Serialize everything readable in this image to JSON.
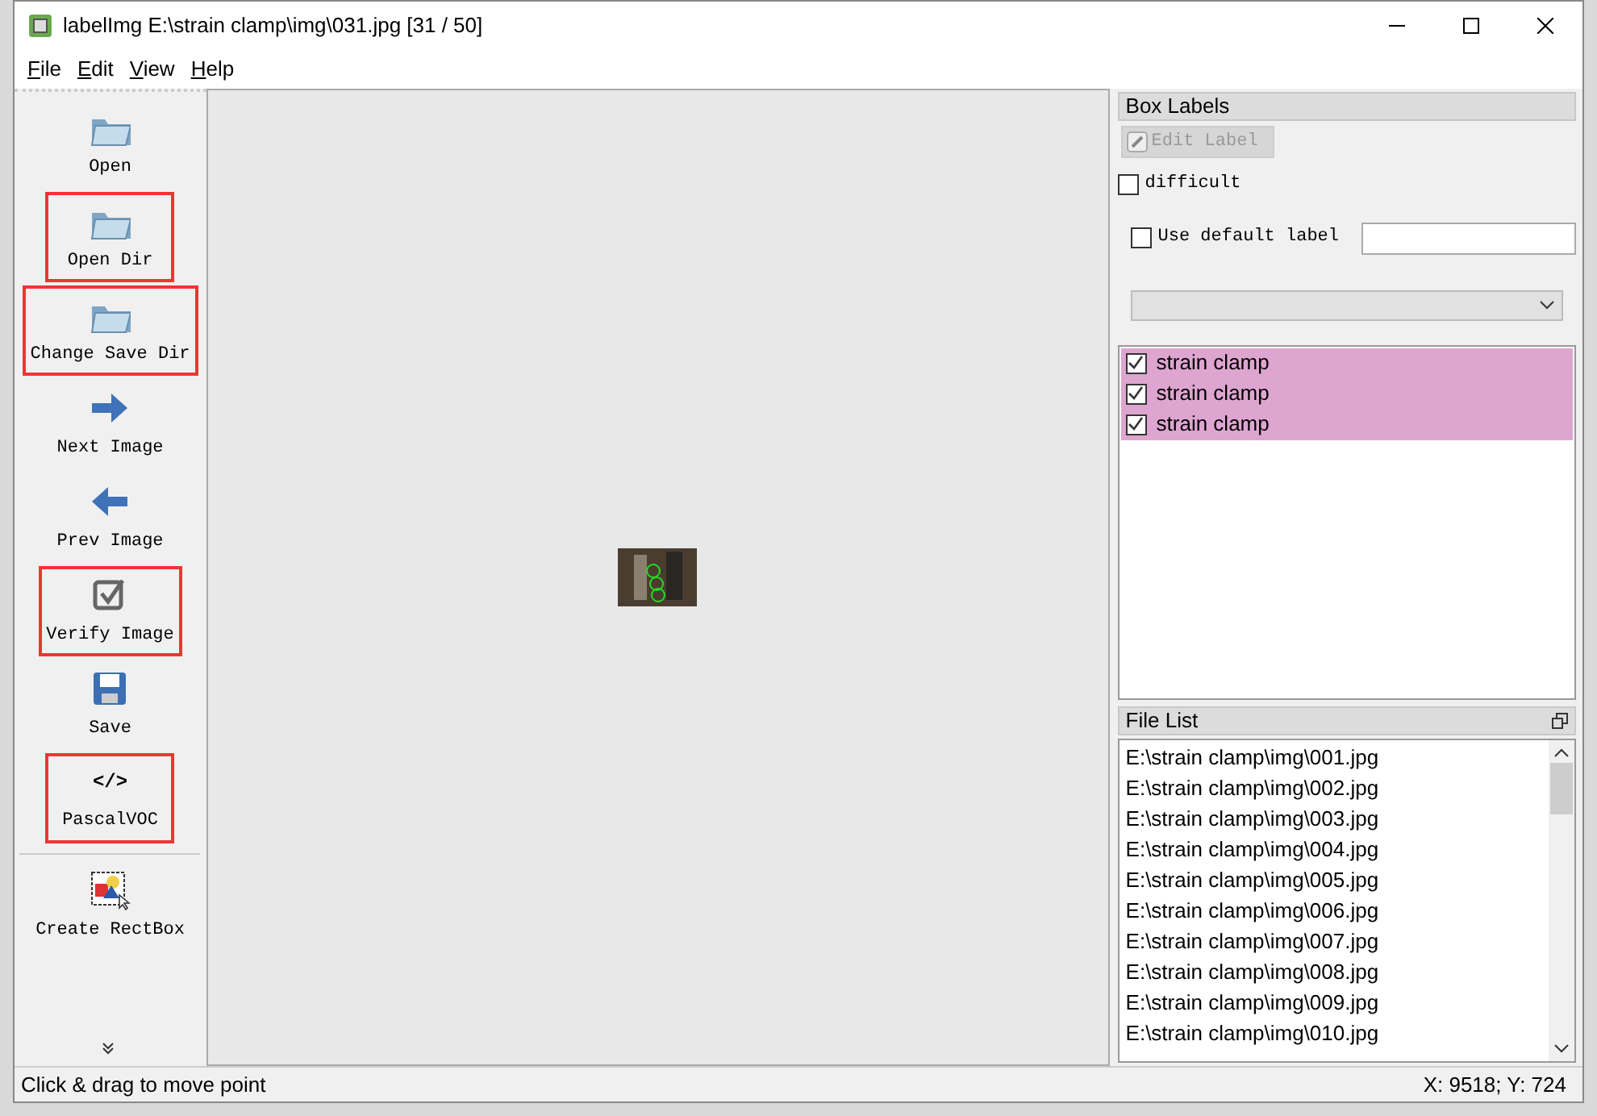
{
  "window": {
    "title": "labelImg E:\\strain clamp\\img\\031.jpg [31 / 50]"
  },
  "menu": [
    {
      "label": "File"
    },
    {
      "label": "Edit"
    },
    {
      "label": "View"
    },
    {
      "label": "Help"
    }
  ],
  "toolbar": [
    {
      "kind": "folder",
      "label": "Open",
      "highlighted": false
    },
    {
      "kind": "folder",
      "label": "Open Dir",
      "highlighted": true
    },
    {
      "kind": "folder",
      "label": "Change Save Dir",
      "highlighted": true
    },
    {
      "kind": "next",
      "label": "Next Image",
      "highlighted": false
    },
    {
      "kind": "prev",
      "label": "Prev Image",
      "highlighted": false
    },
    {
      "kind": "verify",
      "label": "Verify Image",
      "highlighted": true
    },
    {
      "kind": "save",
      "label": "Save",
      "highlighted": false
    },
    {
      "kind": "glyph",
      "glyph": "</>",
      "label": "PascalVOC",
      "highlighted": true
    },
    {
      "kind": "divider"
    },
    {
      "kind": "rectbox",
      "label": "Create RectBox",
      "highlighted": false
    }
  ],
  "box_labels": {
    "title": "Box Labels",
    "edit_button": {
      "label": "Edit Label",
      "disabled": true
    },
    "difficult": {
      "label": "difficult",
      "checked": false
    },
    "use_default": {
      "label": "Use default label",
      "checked": false
    },
    "labels": [
      {
        "text": "strain clamp",
        "checked": true,
        "selected": true
      },
      {
        "text": "strain clamp",
        "checked": true,
        "selected": true
      },
      {
        "text": "strain clamp",
        "checked": true,
        "selected": true
      }
    ]
  },
  "file_list": {
    "title": "File List",
    "files": [
      "E:\\strain clamp\\img\\001.jpg",
      "E:\\strain clamp\\img\\002.jpg",
      "E:\\strain clamp\\img\\003.jpg",
      "E:\\strain clamp\\img\\004.jpg",
      "E:\\strain clamp\\img\\005.jpg",
      "E:\\strain clamp\\img\\006.jpg",
      "E:\\strain clamp\\img\\007.jpg",
      "E:\\strain clamp\\img\\008.jpg",
      "E:\\strain clamp\\img\\009.jpg",
      "E:\\strain clamp\\img\\010.jpg"
    ]
  },
  "status_bar": {
    "message": "Click & drag to move point",
    "coords": "X: 9518; Y: 724"
  }
}
